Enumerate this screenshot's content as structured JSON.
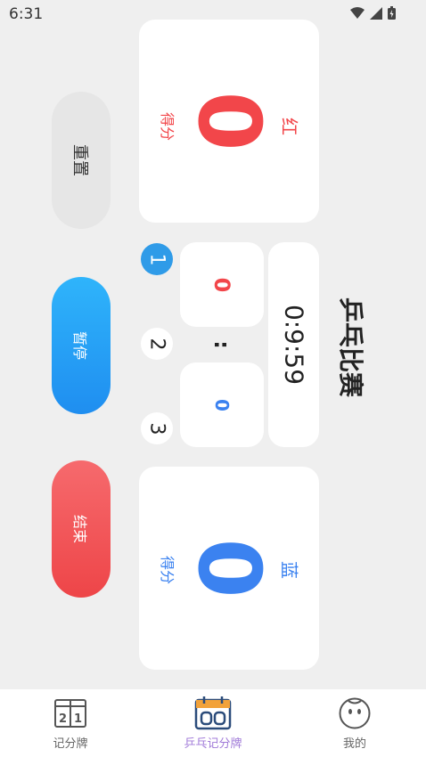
{
  "status": {
    "time": "6:31"
  },
  "title": "乒乓比赛",
  "timer": "0:9:59",
  "red": {
    "label": "红",
    "score": "0",
    "caption": "得分",
    "color": "#f2464a",
    "set_score": "0"
  },
  "blue": {
    "label": "蓝",
    "score": "0",
    "caption": "得分",
    "color": "#3b82f0",
    "set_score": "0"
  },
  "separator": ":",
  "sets": [
    "1",
    "2",
    "3"
  ],
  "buttons": {
    "reset": "重置",
    "pause": "暂停",
    "end": "结束"
  },
  "nav": [
    {
      "label": "记分牌",
      "icon": "scoreboard-icon"
    },
    {
      "label": "乒乓记分牌",
      "icon": "calendar-score-icon"
    },
    {
      "label": "我的",
      "icon": "face-icon"
    }
  ],
  "colors": {
    "accent": "#2f9be8",
    "nav_active": "#a07ad8",
    "end": "#f2464a",
    "reset": "#e6e6e6"
  }
}
